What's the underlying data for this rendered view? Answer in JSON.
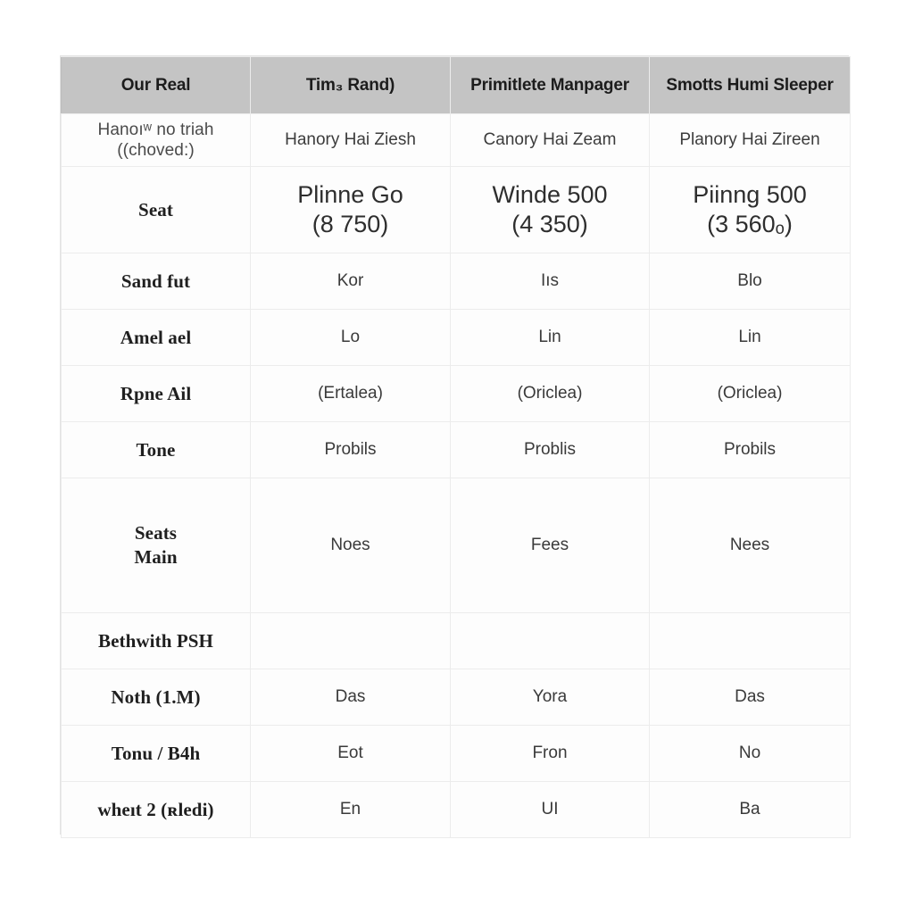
{
  "table": {
    "columns": [
      {
        "key": "label",
        "header": "Our Real"
      },
      {
        "key": "a",
        "header": "Tim₃ Rand)"
      },
      {
        "key": "b",
        "header": "Primitlete Manpager"
      },
      {
        "key": "c",
        "header": "Smotts Humi Sleeper"
      }
    ],
    "rows": [
      {
        "type": "sub",
        "label_line1": "Hanoıʷ no triah",
        "label_line2": "((choved:)",
        "a": "Hanory Hai Ziesh",
        "b": "Canory Hai Zeam",
        "c": "Planory Hai Zireen"
      },
      {
        "type": "big",
        "label_line1": "Seat",
        "label_line2": "",
        "a_line1": "Plinne Go",
        "a_line2": "(8 750)",
        "b_line1": "Winde 500",
        "b_line2": "(4 350)",
        "c_line1": "Piinng 500",
        "c_line2": "(3 560ₒ)"
      },
      {
        "type": "norm",
        "label_line1": "Sand fut",
        "label_line2": "",
        "a": "Kor",
        "b": "Iıs",
        "c": "Blo"
      },
      {
        "type": "norm",
        "label_line1": "Amel ael",
        "label_line2": "",
        "a": "Lo",
        "b": "Lin",
        "c": "Lin"
      },
      {
        "type": "norm",
        "label_line1": "Rpne Ail",
        "label_line2": "",
        "a": "(Ertalea)",
        "b": "(Oriclea)",
        "c": "(Oriclea)"
      },
      {
        "type": "norm",
        "label_line1": "Tone",
        "label_line2": "",
        "a": "Probils",
        "b": "Problis",
        "c": "Probils"
      },
      {
        "type": "tall",
        "label_line1": "Seats",
        "label_line2": "Main",
        "a": "Noes",
        "b": "Fees",
        "c": "Nees"
      },
      {
        "type": "norm",
        "label_line1": "Bethwith PSH",
        "label_line2": "",
        "a": "",
        "b": "",
        "c": ""
      },
      {
        "type": "norm",
        "label_line1": "Noth (1.M)",
        "label_line2": "",
        "a": "Das",
        "b": "Yora",
        "c": "Das"
      },
      {
        "type": "norm",
        "label_line1": "Tonu / B4h",
        "label_line2": "",
        "a": "Eot",
        "b": "Fron",
        "c": "No"
      },
      {
        "type": "norm",
        "label_line1": "wheıt 2 (ʀledi)",
        "label_line2": "",
        "a": "En",
        "b": "UI",
        "c": "Ba"
      }
    ]
  },
  "colors": {
    "header_background": "#c4c4c4",
    "page_background": "#ffffff",
    "grid_line": "#ececec",
    "frame_border": "#e2e2e2",
    "label_text": "#1f1f1f",
    "cell_text": "#3a3a3a"
  }
}
